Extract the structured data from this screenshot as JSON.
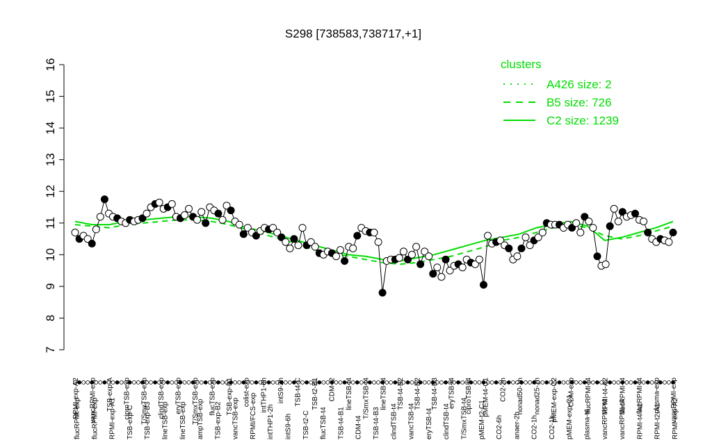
{
  "chart_data": {
    "type": "line",
    "title": "S298 [738583,738717,+1]",
    "xlabel": "",
    "ylabel": "",
    "ylim": [
      7,
      16
    ],
    "yticks": [
      7,
      8,
      9,
      10,
      11,
      12,
      13,
      14,
      15,
      16
    ],
    "grid": false,
    "legend": {
      "title": "clusters",
      "placement": "top-right",
      "color": "#00dd00",
      "entries": [
        {
          "label": "A426 size: 2",
          "style": "dotted"
        },
        {
          "label": "B5 size: 726",
          "style": "dashed"
        },
        {
          "label": "C2 size: 1239",
          "style": "solid"
        }
      ]
    },
    "x_labels_top": [
      "RPMI-exp-A2",
      "vancRPMI-exp",
      "TSB-exp-A",
      "ciproTSB-exp",
      "T/SmxTSB-exp",
      "clindTSB-exp",
      "eryTSB-exp",
      "T/SmxTSB-exp",
      "flucTSB-exp",
      "TSB-exp-B1",
      "colist-exp",
      "intTHP1-6h",
      "intS9-2h",
      "TSB-t4-C",
      "TSB-t2-B1",
      "CDM-t2",
      "lineTSB-t4",
      "T/SmxTSB-t4",
      "lineTSB-t4",
      "TSB-t4-B2",
      "TSB-t4-B2",
      "TSB-t4-B3",
      "eryTSB-t4",
      "ciproTSB-t4",
      "pMEM-t4-C1",
      "CO2-2h",
      "nonad50-1h",
      "nonad25-1h",
      "pMEM-exp-C2",
      "CDM-exp",
      "flucRPMI-t4",
      "RPMI-t4-A2",
      "flucRPMI-t4",
      "flucRPMI-t4",
      "plasma-exp",
      "vancRPMI-exp"
    ],
    "x_labels_bottom": [
      "flucRPMI-exp",
      "flucRPMI-exp",
      "RPMI-exp-A1",
      "TSB-exp-C",
      "TSB-exp-B3",
      "lineTSB-exp",
      "lineTSB-exp",
      "ampTSB-exp",
      "TSB-exp-B2",
      "vancTSB-exp",
      "RPMI/FCS-exp",
      "intTHP1-2h",
      "intS9-6h",
      "TSB-t2-C",
      "flucTSB-t4",
      "TSB-t4-B1",
      "CDM-t4",
      "TSB-t4-B3",
      "clindTSB-t4",
      "vancTSB-t4",
      "eryTSB-t4",
      "clindTSB-t4",
      "T/SmxTSB-t4",
      "pMEM-t2-C1",
      "CO2-6h",
      "anaer-2h",
      "CO2-1h",
      "CO2-1h",
      "pMEM-exp-C1",
      "plasma-t4",
      "vancRPMI-t4",
      "vancRPMI-t4",
      "RPMI-t4-A2",
      "RPMI-t2-A1",
      "RPMI-exp-A2"
    ],
    "samples": [
      10.7,
      10.5,
      10.6,
      10.5,
      10.35,
      10.8,
      11.2,
      11.75,
      11.3,
      11.2,
      11.15,
      11.05,
      11.0,
      11.1,
      11.05,
      11.1,
      11.15,
      11.3,
      11.5,
      11.6,
      11.65,
      11.45,
      11.5,
      11.6,
      11.2,
      11.15,
      11.25,
      11.45,
      11.2,
      11.1,
      11.35,
      11.0,
      11.5,
      11.4,
      11.3,
      11.1,
      11.55,
      11.4,
      11.05,
      10.95,
      10.65,
      10.85,
      10.7,
      10.6,
      10.75,
      10.85,
      10.8,
      10.85,
      10.7,
      10.55,
      10.4,
      10.2,
      10.5,
      10.3,
      10.85,
      10.3,
      10.4,
      10.25,
      10.05,
      10.0,
      10.1,
      10.05,
      9.95,
      10.15,
      9.8,
      10.25,
      10.2,
      10.6,
      10.85,
      10.75,
      10.7,
      10.7,
      10.4,
      8.8,
      9.8,
      9.85,
      9.85,
      9.9,
      10.1,
      9.85,
      10.0,
      10.25,
      9.7,
      10.1,
      9.95,
      9.4,
      9.6,
      9.3,
      9.85,
      9.5,
      9.65,
      9.7,
      9.6,
      9.85,
      9.75,
      9.7,
      9.85,
      9.05,
      10.6,
      10.35,
      10.4,
      10.45,
      10.3,
      10.2,
      9.85,
      9.95,
      10.2,
      10.55,
      10.3,
      10.45,
      10.55,
      10.7,
      11.0,
      10.95,
      10.95,
      10.95,
      10.85,
      10.95,
      10.85,
      11.0,
      10.7,
      11.2,
      11.05,
      10.85,
      9.95,
      9.65,
      9.7,
      10.9,
      11.45,
      11.05,
      11.35,
      11.2,
      11.25,
      11.3,
      11.1,
      11.05,
      10.7,
      10.5,
      10.4,
      10.5,
      10.45,
      10.4,
      10.7
    ],
    "cluster_lines": [
      {
        "name": "B5 size: 726",
        "style": "dashed",
        "values": [
          10.95,
          10.9,
          10.85,
          10.95,
          11.0,
          11.05,
          11.1,
          11.1,
          11.05,
          10.95,
          10.8,
          10.65,
          10.5,
          10.35,
          10.15,
          10.05,
          9.95,
          9.85,
          9.75,
          9.7,
          9.75,
          9.85,
          9.95,
          10.1,
          10.25,
          10.45,
          10.55,
          10.7,
          10.85,
          10.95,
          10.85,
          10.6,
          10.5,
          10.6,
          10.75,
          10.9
        ]
      },
      {
        "name": "C2 size: 1239",
        "style": "solid",
        "values": [
          11.05,
          10.95,
          10.95,
          11.05,
          11.1,
          11.15,
          11.2,
          11.2,
          11.15,
          11.05,
          10.85,
          10.75,
          10.6,
          10.45,
          10.3,
          10.15,
          10.0,
          9.95,
          9.85,
          9.8,
          9.9,
          10.0,
          10.15,
          10.3,
          10.45,
          10.55,
          10.65,
          10.85,
          10.95,
          11.05,
          10.9,
          10.45,
          10.55,
          10.7,
          10.85,
          11.05
        ]
      }
    ]
  }
}
